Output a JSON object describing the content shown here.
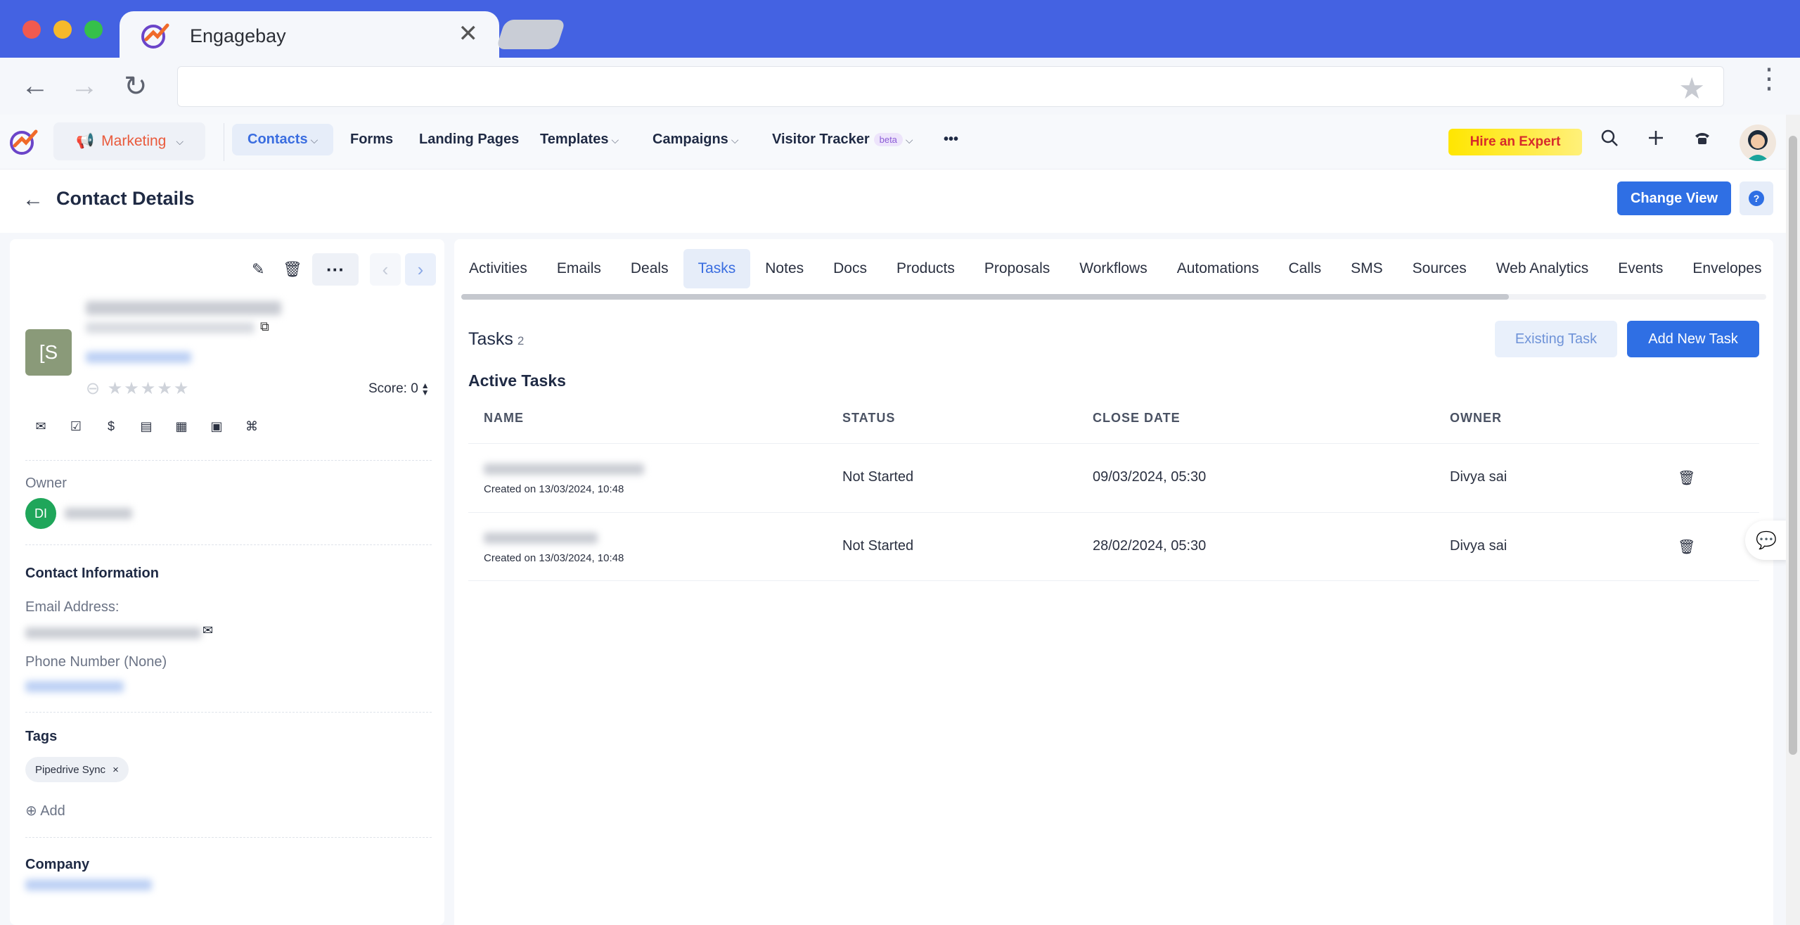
{
  "browser": {
    "tab_title": "Engagebay",
    "tab_close": "✕",
    "back": "←",
    "forward": "→",
    "reload": "↻",
    "bookmark": "★",
    "menu": "⋮"
  },
  "appnav": {
    "marketing": "Marketing",
    "items": {
      "contacts": "Contacts",
      "forms": "Forms",
      "landing_pages": "Landing Pages",
      "templates": "Templates",
      "campaigns": "Campaigns",
      "visitor_tracker": "Visitor Tracker",
      "beta": "beta",
      "more": "•••"
    },
    "hire": "Hire an Expert",
    "icons": [
      "search-icon",
      "plus-icon",
      "phone-icon",
      "avatar"
    ]
  },
  "header": {
    "title": "Contact Details",
    "change_view": "Change View",
    "help": "?"
  },
  "contact": {
    "initial": "[S",
    "score_label": "Score: 0",
    "owner_label": "Owner",
    "owner_initials": "DI",
    "contact_info": "Contact Information",
    "email_label": "Email Address:",
    "phone_label": "Phone Number (None)",
    "tags_label": "Tags",
    "tag": "Pipedrive Sync",
    "tag_remove": "×",
    "add": "Add",
    "company_label": "Company"
  },
  "tabs": [
    "Activities",
    "Emails",
    "Deals",
    "Tasks",
    "Notes",
    "Docs",
    "Products",
    "Proposals",
    "Workflows",
    "Automations",
    "Calls",
    "SMS",
    "Sources",
    "Web Analytics",
    "Events",
    "Envelopes"
  ],
  "active_tab": "Tasks",
  "tasks": {
    "title": "Tasks",
    "count": "2",
    "existing_task": "Existing Task",
    "add_new_task": "Add New Task",
    "active_heading": "Active Tasks",
    "columns": [
      "NAME",
      "STATUS",
      "CLOSE DATE",
      "OWNER"
    ],
    "rows": [
      {
        "created": "Created on 13/03/2024, 10:48",
        "status": "Not Started",
        "close_date": "09/03/2024, 05:30",
        "owner": "Divya sai"
      },
      {
        "created": "Created on 13/03/2024, 10:48",
        "status": "Not Started",
        "close_date": "28/02/2024, 05:30",
        "owner": "Divya sai"
      }
    ]
  }
}
